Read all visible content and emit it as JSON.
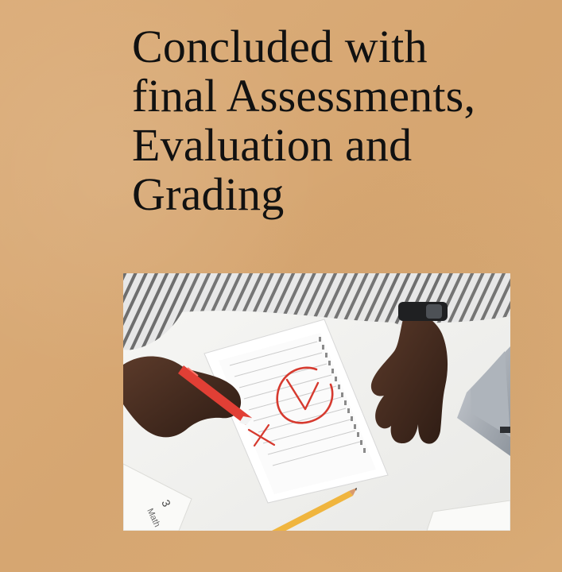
{
  "slide": {
    "title_lines": [
      "Concluded with",
      "final Assessments,",
      "Evaluation and",
      "Grading"
    ]
  },
  "photo": {
    "description": "grading-exam-sheet-image"
  },
  "colors": {
    "background": "#d8aa77",
    "title": "#111111",
    "mark_red": "#d63a2f"
  }
}
